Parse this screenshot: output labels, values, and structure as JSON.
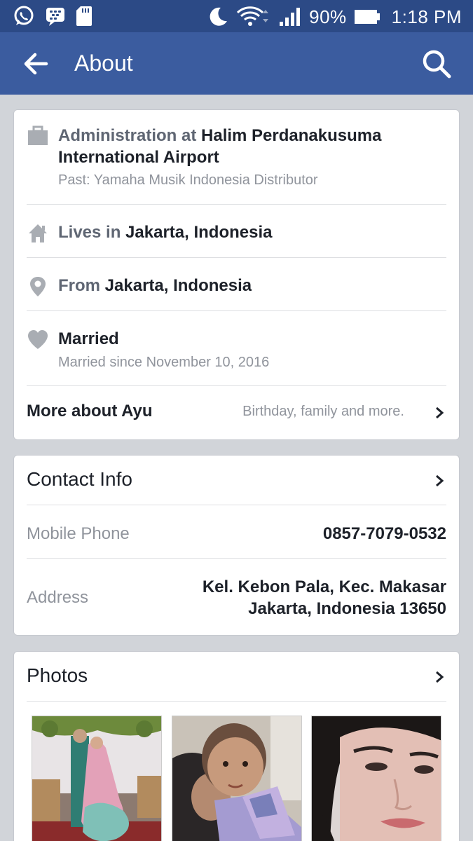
{
  "status_bar": {
    "battery": "90%",
    "time": "1:18 PM",
    "icons": [
      "whatsapp-icon",
      "bbm-icon",
      "sd-card-icon",
      "moon-icon",
      "wifi-icon",
      "signal-icon",
      "battery-icon"
    ]
  },
  "app_bar": {
    "title": "About",
    "icons": [
      "back-arrow-icon",
      "search-icon"
    ]
  },
  "about": {
    "work": {
      "icon": "briefcase-icon",
      "prefix": "Administration at ",
      "place_line1": "Halim Perdanakusuma",
      "place_line2": "International Airport",
      "past": "Past: Yamaha Musik Indonesia Distributor"
    },
    "lives": {
      "icon": "home-icon",
      "prefix": "Lives in ",
      "place": "Jakarta, Indonesia"
    },
    "from": {
      "icon": "location-pin-icon",
      "prefix": "From ",
      "place": "Jakarta, Indonesia"
    },
    "relationship": {
      "icon": "heart-icon",
      "status": "Married",
      "detail": "Married since November 10, 2016"
    },
    "more": {
      "title": "More about Ayu",
      "subtitle": "Birthday, family and more."
    }
  },
  "contact": {
    "title": "Contact Info",
    "mobile_label": "Mobile Phone",
    "mobile_value": "0857-7079-0532",
    "address_label": "Address",
    "address_line1": "Kel. Kebon Pala, Kec. Makasar",
    "address_line2": "Jakarta, Indonesia 13650"
  },
  "photos": {
    "title": "Photos"
  },
  "colors": {
    "status_bar": "#2c4a86",
    "app_bar": "#3b5c9f",
    "page_bg": "#d1d4d9",
    "card_bg": "#ffffff",
    "primary_text": "#1d2129",
    "muted_text": "#90949c",
    "icon_gray": "#a9adb3"
  }
}
